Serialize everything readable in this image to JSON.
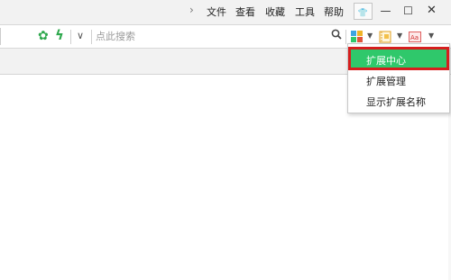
{
  "titlebar": {
    "menu": [
      "文件",
      "查看",
      "收藏",
      "工具",
      "帮助"
    ],
    "chevron": "›",
    "controls": {
      "skin": "👕",
      "minimize": "—",
      "maximize": "☐",
      "close": "✕"
    }
  },
  "addressbar": {
    "dropdown_arrow": "∨",
    "search_placeholder": "点此搜索",
    "search_icon": "search-icon"
  },
  "extensions_menu": {
    "items": [
      "扩展中心",
      "扩展管理",
      "显示扩展名称"
    ],
    "active_index": 0
  },
  "colors": {
    "active_bg": "#2fc86b",
    "highlight_border": "#d61e1e",
    "accent_green": "#2ea84d"
  }
}
